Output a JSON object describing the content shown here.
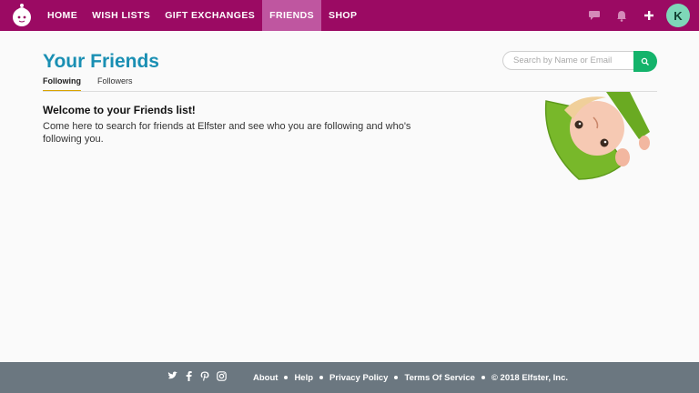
{
  "colors": {
    "nav_bg": "#9b0a63",
    "nav_active": "#bf56a0",
    "title": "#1a8fb3",
    "search_button": "#14b36b",
    "tab_underline": "#d9a400",
    "footer_bg": "#6b7780",
    "avatar_bg": "#7ed7b8"
  },
  "nav": {
    "logo_icon": "elf-logo-icon",
    "items": [
      {
        "label": "HOME"
      },
      {
        "label": "WISH LISTS"
      },
      {
        "label": "GIFT EXCHANGES"
      },
      {
        "label": "FRIENDS",
        "active": true
      },
      {
        "label": "SHOP"
      }
    ],
    "icons": [
      "chat-icon",
      "bell-icon",
      "plus-icon"
    ],
    "avatar_initial": "K"
  },
  "page": {
    "title": "Your Friends",
    "search": {
      "placeholder": "Search by Name or Email",
      "button_icon": "search-icon"
    },
    "tabs": [
      {
        "label": "Following",
        "active": true
      },
      {
        "label": "Followers"
      }
    ],
    "welcome": {
      "title": "Welcome to your Friends list!",
      "text": "Come here to search for friends at Elfster and see who you are following and who's following you."
    },
    "illustration": "upside-down-elf-illustration"
  },
  "footer": {
    "social_icons": [
      "twitter-icon",
      "facebook-icon",
      "pinterest-icon",
      "instagram-icon"
    ],
    "links": [
      {
        "label": "About"
      },
      {
        "label": "Help"
      },
      {
        "label": "Privacy Policy"
      },
      {
        "label": "Terms Of Service"
      }
    ],
    "copyright": "© 2018 Elfster, Inc."
  }
}
